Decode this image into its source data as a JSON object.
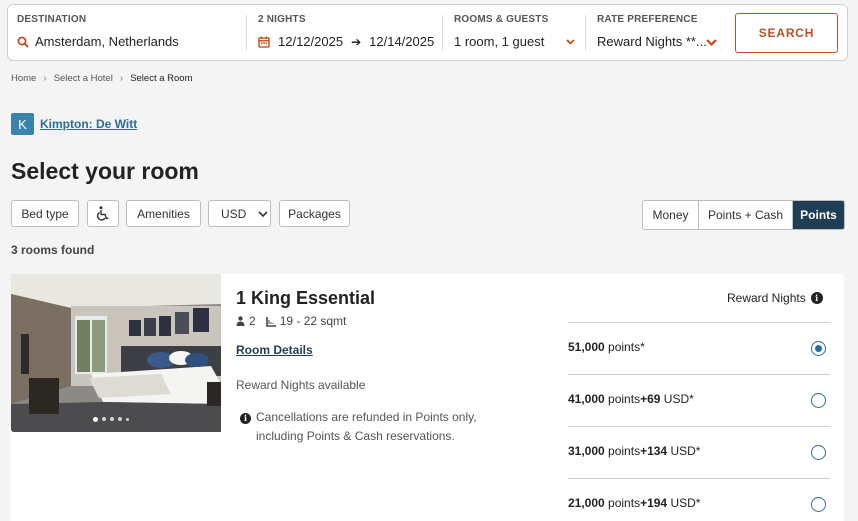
{
  "search": {
    "destination_label": "DESTINATION",
    "destination_value": "Amsterdam, Netherlands",
    "nights_label": "2 NIGHTS",
    "checkin": "12/12/2025",
    "checkout": "12/14/2025",
    "rooms_label": "ROOMS & GUESTS",
    "rooms_value": "1 room, 1 guest",
    "rate_label": "RATE PREFERENCE",
    "rate_value": "Reward Nights **...",
    "search_button": "SEARCH"
  },
  "breadcrumb": [
    "Home",
    "Select a Hotel",
    "Select a Room"
  ],
  "hotel": {
    "badge": "K",
    "name": "Kimpton: De Witt"
  },
  "page_title": "Select your room",
  "filters": {
    "bed_type": "Bed type",
    "amenities": "Amenities",
    "currency": "USD",
    "packages": "Packages"
  },
  "payment_toggle": {
    "options": [
      "Money",
      "Points + Cash",
      "Points"
    ],
    "active": "Points"
  },
  "rooms_found": "3 rooms found",
  "room": {
    "name": "1 King Essential",
    "guests": "2",
    "size": "19 - 22 sqmt",
    "details_link": "Room Details",
    "availability": "Reward Nights available",
    "cancellation": "Cancellations are refunded in Points only, including Points & Cash reservations.",
    "rate_type": "Reward Nights",
    "image_dots": 5,
    "rates": [
      {
        "points": "51,000",
        "points_label": "points*",
        "cash": "",
        "cash_label": "",
        "selected": true
      },
      {
        "points": "41,000",
        "points_label": "points",
        "cash": "+69",
        "cash_label": "USD*",
        "selected": false
      },
      {
        "points": "31,000",
        "points_label": "points",
        "cash": "+134",
        "cash_label": "USD*",
        "selected": false
      },
      {
        "points": "21,000",
        "points_label": "points",
        "cash": "+194",
        "cash_label": "USD*",
        "selected": false
      }
    ]
  },
  "colors": {
    "accent_orange": "#c2410c",
    "brand_blue": "#3b82ad",
    "active_toggle": "#1f3e53"
  }
}
